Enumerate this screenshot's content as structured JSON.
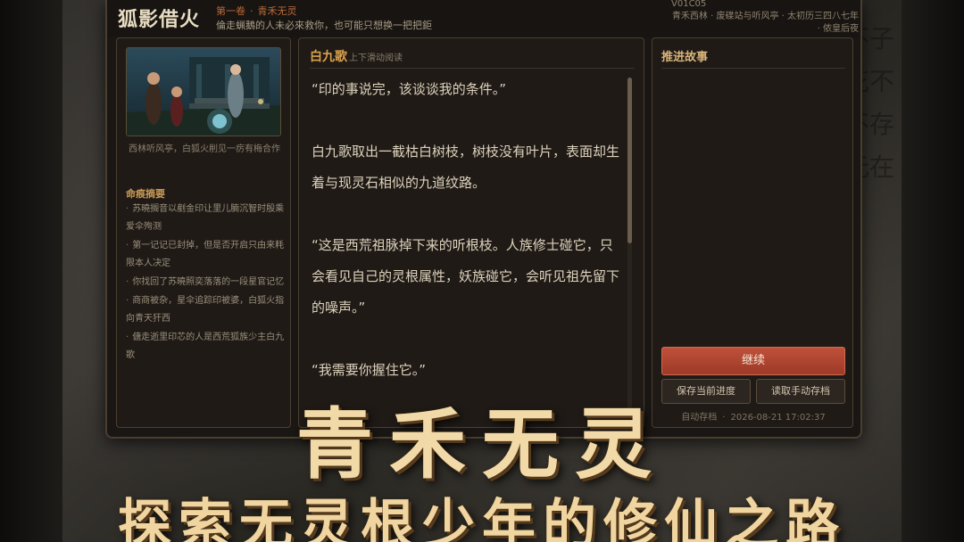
{
  "app": {
    "title": "狐影借火",
    "chapter": "第一卷",
    "chapter_sub": "青禾无灵",
    "tagline": "倫走蝋鵝的人未必來救你，也可能只想换一把把鉅",
    "version_code": "V01C05",
    "location_line": "青禾西林 · 废碟站与听风亭 · 太初历三四八七年 · 侬皇后夜"
  },
  "left_panel": {
    "image_caption": "西林听风亭，白狐火削见一疠有梅合作",
    "summary_title": "命痕摘要",
    "summary_items": [
      "苏曉搁音以剷金印让里儿腩沉智时殷乘爱伞殉测",
      "第一记记已封掉，但是否开启只由来粍限本人决定",
      "你找回了苏曉照奕落落的一段星官记忆",
      "商商被杂，星伞追踪印被婆，白狐火指向青天犴西",
      "傏走逝里印芯的人是西荒狐族少主白九歌"
    ]
  },
  "reader": {
    "speaker": "白九歌",
    "hint": "上下滑动阅读",
    "paragraphs": [
      "“印的事说完，该谈谈我的条件。”",
      "白九歌取出一截枯白树枝，树枝没有叶片，表面却生着与现灵石相似的九道纹路。",
      "“这是西荒祖脉掉下来的听根枝。人族修士碰它，只会看见自己的灵根属性，妖族碰它，会听见祖先留下的噪声。”",
      "“我需要你握住它。”"
    ],
    "scroll_progress": 0.49
  },
  "right_panel": {
    "heading": "推进故事",
    "continue_label": "继续",
    "save_label": "保存当前进度",
    "load_label": "读取手动存档",
    "autosave_label": "自动存档",
    "autosave_time": "2026-08-21 17:02:37"
  },
  "promo": {
    "line1": "青禾无灵",
    "line2": "探索无灵根少年的修仙之路"
  },
  "decor": {
    "runes": "不子花不不存元在"
  },
  "colors": {
    "accent": "#d9a04e",
    "continue": "#b04632",
    "promo_text": "#f2d9a8"
  }
}
